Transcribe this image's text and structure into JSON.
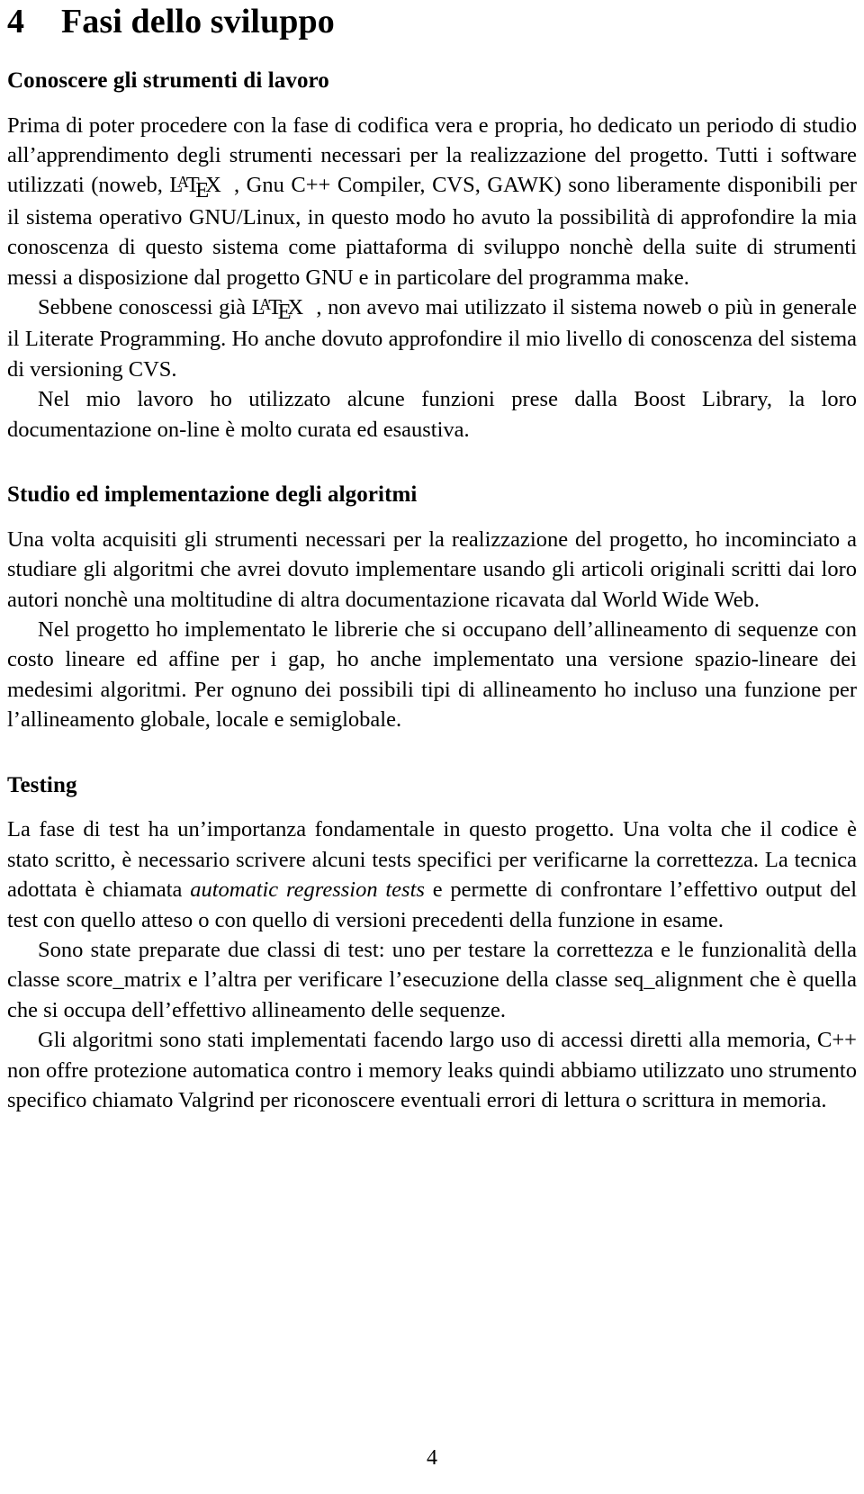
{
  "document": {
    "section": {
      "number": "4",
      "title": "Fasi dello sviluppo"
    },
    "subsections": [
      {
        "id": "conoscere",
        "heading": "Conoscere gli strumenti di lavoro",
        "paragraphs": [
          {
            "id": "p1",
            "indent": false,
            "text_before_latex": "Prima di poter procedere con la fase di codifica vera e propria, ho dedicato un periodo di studio all’apprendimento degli strumenti necessari per la realizzazione del progetto. Tutti i software utilizzati (noweb, ",
            "latex_label": "LaTeX",
            "text_after_latex": ", Gnu C++ Compiler, CVS, GAWK) sono liberamente disponibili per il sistema operativo GNU/Linux, in questo modo ho avuto la possibilità di approfondire la mia conoscenza di questo sistema come piattaforma di sviluppo nonchè della suite di strumenti messi a disposizione dal progetto GNU e in particolare del programma make."
          },
          {
            "id": "p2",
            "indent": true,
            "text_before_latex": "Sebbene conoscessi già ",
            "latex_label": "LaTeX",
            "text_after_latex": ", non avevo mai utilizzato il sistema noweb o più in generale il Literate Programming. Ho anche dovuto approfondire il mio livello di conoscenza del sistema di versioning CVS."
          },
          {
            "id": "p3",
            "indent": true,
            "text": "Nel mio lavoro ho utilizzato alcune funzioni prese dalla Boost Library, la loro documentazione on-line è molto curata ed esaustiva."
          }
        ]
      },
      {
        "id": "studio",
        "heading": "Studio ed implementazione degli algoritmi",
        "paragraphs": [
          {
            "id": "p4",
            "indent": false,
            "text": "Una volta acquisiti gli strumenti necessari per la realizzazione del progetto, ho incominciato a studiare gli algoritmi che avrei dovuto implementare usando gli articoli originali scritti dai loro autori nonchè una moltitudine di altra documentazione ricavata dal World Wide Web."
          },
          {
            "id": "p5",
            "indent": true,
            "text": "Nel progetto ho implementato le librerie che si occupano dell’allineamento di sequenze con costo lineare ed affine per i gap, ho anche implementato una versione spazio-lineare dei medesimi algoritmi. Per ognuno dei possibili tipi di allineamento ho incluso una funzione per l’allineamento globale, locale e semiglobale."
          }
        ]
      },
      {
        "id": "testing",
        "heading": "Testing",
        "paragraphs": [
          {
            "id": "p6",
            "indent": false,
            "segments": [
              {
                "style": "normal",
                "text": "La fase di test ha un’importanza fondamentale in questo progetto.  Una volta che il codice è stato scritto, è necessario scrivere alcuni tests specifici per verificarne la correttezza.  La tecnica adottata è chiamata "
              },
              {
                "style": "italic",
                "text": "automatic regression tests"
              },
              {
                "style": "normal",
                "text": " e permette di confrontare l’effettivo output del test con quello atteso o con quello di versioni precedenti della funzione in esame."
              }
            ]
          },
          {
            "id": "p7",
            "indent": true,
            "segments": [
              {
                "style": "normal",
                "text": "Sono state preparate due classi di test: uno per testare la correttezza e le funzionalità della classe "
              },
              {
                "style": "code",
                "text": "score_matrix"
              },
              {
                "style": "normal",
                "text": " e l’altra per verificare l’esecuzione della classe "
              },
              {
                "style": "code",
                "text": "seq_alignment"
              },
              {
                "style": "normal",
                "text": " che è quella che si occupa dell’effettivo allineamento delle sequenze."
              }
            ]
          },
          {
            "id": "p8",
            "indent": true,
            "text": "Gli algoritmi sono stati implementati facendo largo uso di accessi diretti alla memoria, C++ non offre protezione automatica contro i memory leaks quindi abbiamo utilizzato uno strumento specifico chiamato Valgrind per riconoscere eventuali errori di lettura o scrittura in memoria."
          }
        ]
      }
    ],
    "footer": {
      "page_number": "4"
    }
  }
}
